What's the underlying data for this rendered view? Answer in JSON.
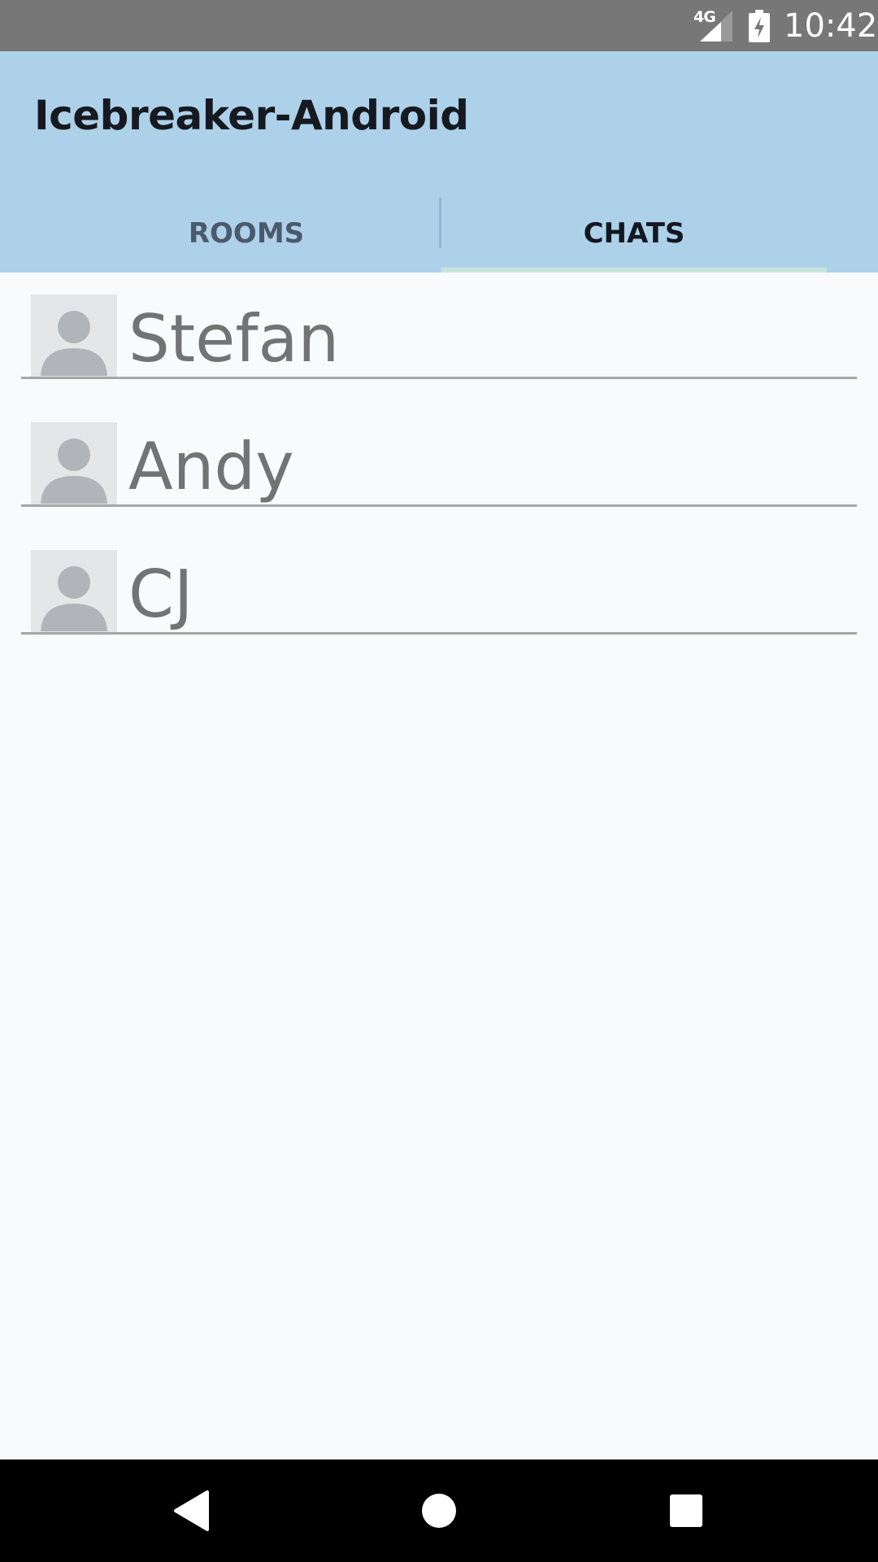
{
  "status_bar": {
    "network_label": "4G",
    "time": "10:42",
    "icons": [
      "signal-icon",
      "battery-charging-icon"
    ]
  },
  "app_bar": {
    "title": "Icebreaker-Android",
    "tabs": [
      {
        "label": "ROOMS",
        "selected": false
      },
      {
        "label": "CHATS",
        "selected": true
      }
    ],
    "background_color": "#aed1ea"
  },
  "chats": [
    {
      "name": "Stefan",
      "avatar": "default-person-icon"
    },
    {
      "name": "Andy",
      "avatar": "default-person-icon"
    },
    {
      "name": "CJ",
      "avatar": "default-person-icon"
    }
  ],
  "nav_bar": {
    "icons": [
      "back-icon",
      "home-icon",
      "recents-icon"
    ]
  }
}
